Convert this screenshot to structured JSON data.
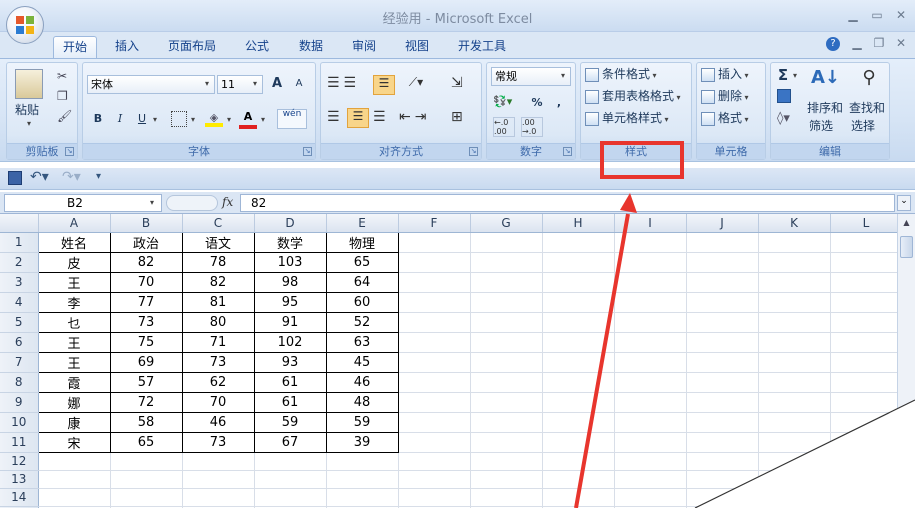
{
  "window": {
    "title": "经验用 - Microsoft Excel"
  },
  "ribbon": {
    "tabs": [
      "开始",
      "插入",
      "页面布局",
      "公式",
      "数据",
      "审阅",
      "视图",
      "开发工具"
    ],
    "groups": {
      "clipboard": {
        "label": "剪贴板",
        "paste": "粘贴"
      },
      "font": {
        "label": "字体",
        "name": "宋体",
        "size": "11",
        "bold": "B",
        "italic": "I",
        "underline": "U",
        "grow": "A",
        "shrink": "A",
        "color_letter": "A",
        "wen": "wén"
      },
      "alignment": {
        "label": "对齐方式"
      },
      "number": {
        "label": "数字",
        "format": "常规",
        "percent": "%",
        "comma": ","
      },
      "styles": {
        "label": "样式",
        "conditional": "条件格式",
        "table_format": "套用表格格式",
        "cell_styles": "单元格样式"
      },
      "cells": {
        "label": "单元格",
        "insert": "插入",
        "delete": "删除",
        "format": "格式"
      },
      "editing": {
        "label": "编辑",
        "sigma": "Σ",
        "sort": "排序和",
        "sort2": "筛选",
        "find": "查找和",
        "find2": "选择"
      }
    }
  },
  "formula_bar": {
    "name_box": "B2",
    "fx": "fx",
    "content": "82"
  },
  "sheet": {
    "columns": [
      "A",
      "B",
      "C",
      "D",
      "E",
      "F",
      "G",
      "H",
      "I",
      "J",
      "K",
      "L"
    ],
    "rows": [
      [
        "姓名",
        "政治",
        "语文",
        "数学",
        "物理"
      ],
      [
        "皮",
        "82",
        "78",
        "103",
        "65"
      ],
      [
        "王",
        "70",
        "82",
        "98",
        "64"
      ],
      [
        "李",
        "77",
        "81",
        "95",
        "60"
      ],
      [
        "乜",
        "73",
        "80",
        "91",
        "52"
      ],
      [
        "王",
        "75",
        "71",
        "102",
        "63"
      ],
      [
        "王",
        "69",
        "73",
        "93",
        "45"
      ],
      [
        "霞",
        "57",
        "62",
        "61",
        "46"
      ],
      [
        "娜",
        "72",
        "70",
        "61",
        "48"
      ],
      [
        "康",
        "58",
        "46",
        "59",
        "59"
      ],
      [
        "宋",
        "65",
        "73",
        "67",
        "39"
      ],
      [],
      [],
      [],
      []
    ]
  },
  "colors": {
    "ribbon_text": "#15428b",
    "annotation": "#e8352d"
  }
}
